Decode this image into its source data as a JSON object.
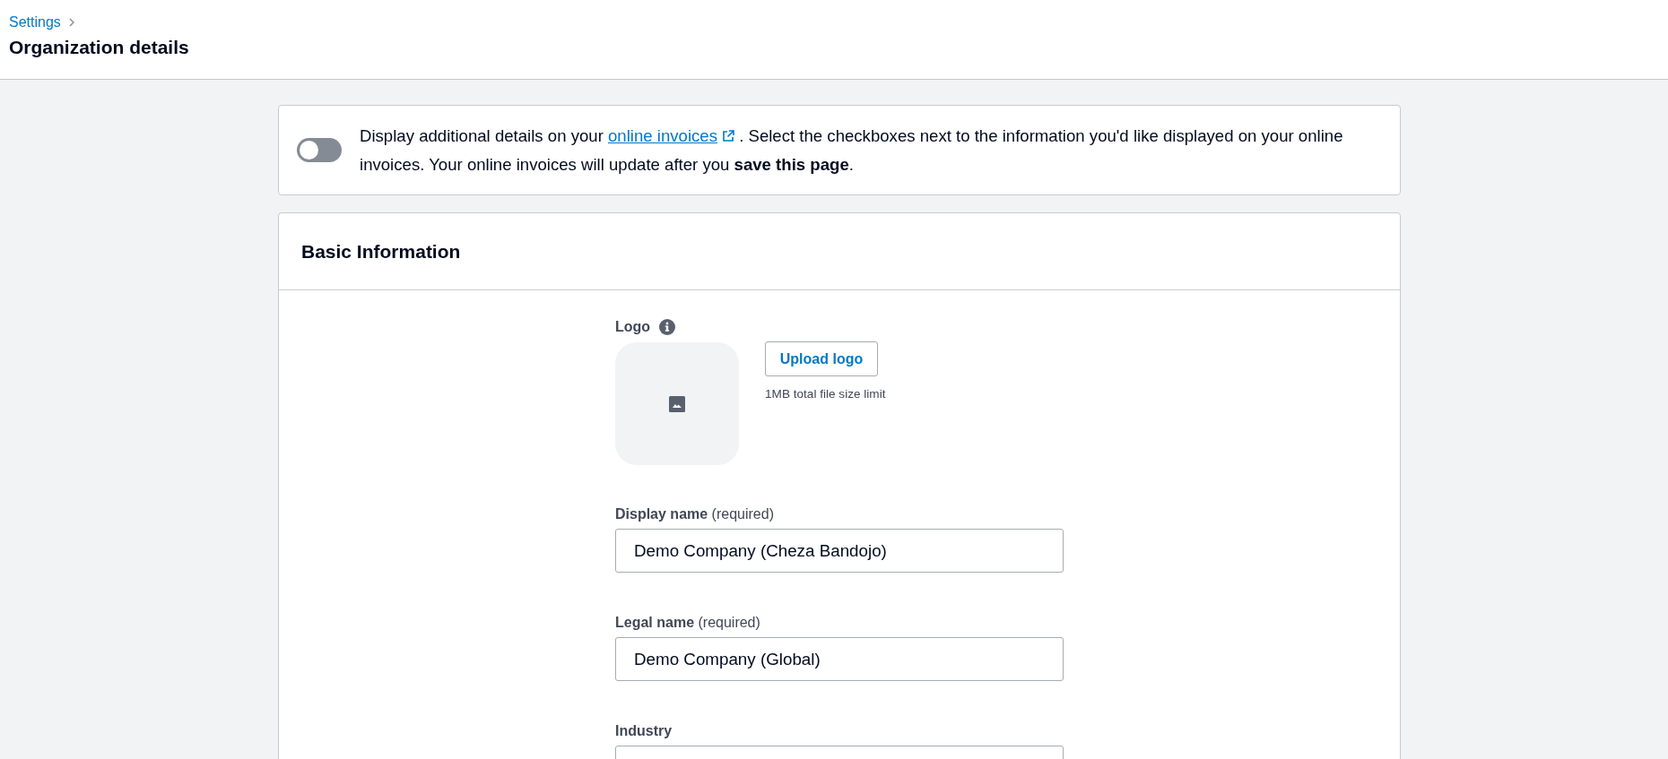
{
  "header": {
    "breadcrumb": [
      "Settings"
    ],
    "title": "Organization details"
  },
  "banner": {
    "toggle": {
      "on": false
    },
    "text_before": "Display additional details on your",
    "link": "online invoices",
    "text_after": ". Select the checkboxes next to the information you'd like displayed on your online invoices. Your online invoices will update after you **save this page**."
  },
  "basic_information": {
    "title": "Basic Information",
    "logo": {
      "label": "Logo",
      "upload_button": "Upload logo",
      "hint": "1MB total file size limit"
    },
    "fields": [
      {
        "label": "Display name",
        "note": "(required)",
        "value": "Demo Company (Cheza Bandojo)"
      },
      {
        "label": "Legal name",
        "note": "(required)",
        "value": "Demo Company (Global)"
      },
      {
        "label": "Industry"
      }
    ]
  }
}
